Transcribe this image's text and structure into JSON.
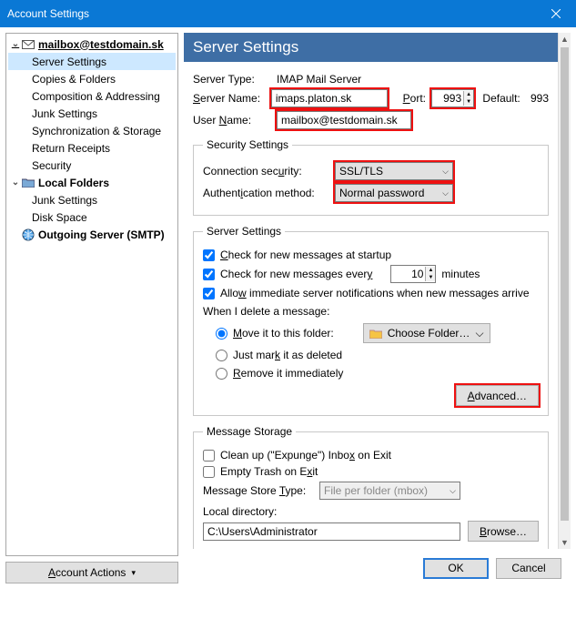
{
  "window": {
    "title": "Account Settings"
  },
  "sidebar": {
    "account": "mailbox@testdomain.sk",
    "items": [
      "Server Settings",
      "Copies & Folders",
      "Composition & Addressing",
      "Junk Settings",
      "Synchronization & Storage",
      "Return Receipts",
      "Security"
    ],
    "local_folders": "Local Folders",
    "local_items": [
      "Junk Settings",
      "Disk Space"
    ],
    "outgoing": "Outgoing Server (SMTP)",
    "account_actions": "ccount Actions",
    "account_actions_u": "A"
  },
  "page": {
    "heading": "Server Settings",
    "server_type_label": "Server Type:",
    "server_type_value": "IMAP Mail Server",
    "server_name_label": "Server Name:",
    "server_name_u": "S",
    "server_name_value": "imaps.platon.sk",
    "port_label": "ort:",
    "port_u": "P",
    "port_value": "993",
    "default_label": "Default:",
    "default_value": "993",
    "user_name_label": "User ",
    "user_name_u": "N",
    "user_name_label2": "ame:",
    "user_name_value": "mailbox@testdomain.sk"
  },
  "security": {
    "legend": "Security Settings",
    "conn_label": "Connection sec",
    "conn_u": "u",
    "conn_label2": "rity:",
    "conn_value": "SSL/TLS",
    "auth_label": "Authent",
    "auth_u": "i",
    "auth_label2": "cation method:",
    "auth_value": "Normal password"
  },
  "server": {
    "legend": "Server Settings",
    "chk_startup": "heck for new messages at startup",
    "chk_startup_u": "C",
    "chk_every1": "Check for new messages ever",
    "chk_every_u": "y",
    "chk_every_value": "10",
    "chk_every_unit": "minutes",
    "chk_immediate1": "Allo",
    "chk_immediate_u": "w",
    "chk_immediate2": " immediate server notifications when new messages arrive",
    "delete_label": "When I delete a message:",
    "r_move": "ove it to this folder:",
    "r_move_u": "M",
    "folder_select": "Choose Folder…",
    "r_mark": "Just mar",
    "r_mark_u": "k",
    "r_mark2": " it as deleted",
    "r_remove": "emove it immediately",
    "r_remove_u": "R",
    "advanced": "dvanced…",
    "advanced_u": "A"
  },
  "storage": {
    "legend": "Message Storage",
    "chk_expunge": "Clean up (\"Expunge\") Inbo",
    "chk_expunge_u": "x",
    "chk_expunge2": " on Exit",
    "chk_empty": "Empty Trash on E",
    "chk_empty_u": "x",
    "chk_empty2": "it",
    "store_type_label": "Message Store ",
    "store_type_u": "T",
    "store_type_label2": "ype:",
    "store_type_value": "File per folder (mbox)",
    "local_dir_label": "Local directory:",
    "local_dir_value": "C:\\Users\\Administrator",
    "browse": "rowse…",
    "browse_u": "B"
  },
  "footer": {
    "ok": "OK",
    "cancel": "Cancel"
  }
}
